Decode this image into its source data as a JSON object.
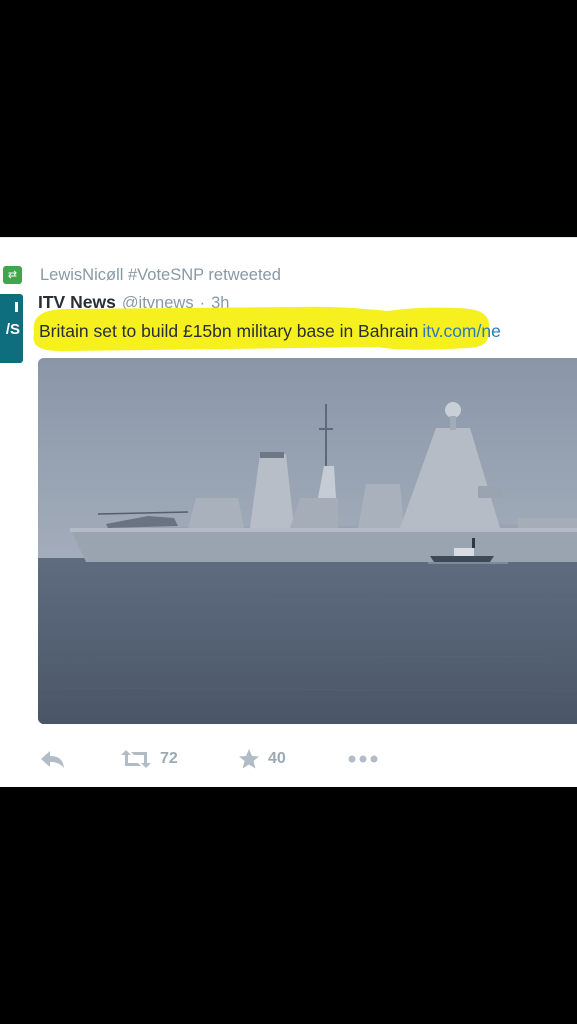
{
  "context": {
    "retweeted_by": "LewisNicøll #VoteSNP retweeted"
  },
  "tweet": {
    "author_name": "ITV News",
    "author_handle": "@itvnews",
    "separator": "·",
    "time": "3h",
    "text": "Britain set to build £15bn military base in Bahrain",
    "link_text": "itv.com/ne",
    "avatar_text": "/S",
    "photo_alt_icon": "warship-photo"
  },
  "actions": {
    "reply_icon": "reply-icon",
    "retweet_icon": "retweet-icon",
    "retweet_count": "72",
    "favorite_icon": "star-icon",
    "favorite_count": "40",
    "more_icon": "more-icon"
  },
  "colors": {
    "highlight": "#f5f01e",
    "retweet_green": "#3fa64b",
    "avatar_teal": "#0f6e7e",
    "link_blue": "#2b7bb9",
    "muted": "#8899a6"
  }
}
